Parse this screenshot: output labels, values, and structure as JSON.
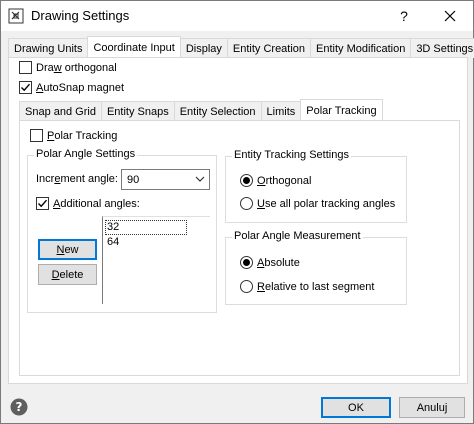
{
  "window": {
    "title": "Drawing Settings",
    "help_glyph": "?",
    "close_glyph": "✕"
  },
  "outer_tabs": [
    {
      "label": "Drawing Units",
      "active": false
    },
    {
      "label": "Coordinate Input",
      "active": true
    },
    {
      "label": "Display",
      "active": false
    },
    {
      "label": "Entity Creation",
      "active": false
    },
    {
      "label": "Entity Modification",
      "active": false
    },
    {
      "label": "3D Settings",
      "active": false
    }
  ],
  "coordinate_input": {
    "draw_orthogonal": {
      "label_pre": "Dra",
      "label_u": "w",
      "label_post": " orthogonal",
      "checked": false
    },
    "autosnap_magnet": {
      "label_pre": "",
      "label_u": "A",
      "label_post": "utoSnap magnet",
      "checked": true
    }
  },
  "inner_tabs": [
    {
      "label": "Snap and Grid",
      "active": false
    },
    {
      "label": "Entity Snaps",
      "active": false
    },
    {
      "label": "Entity Selection",
      "active": false
    },
    {
      "label": "Limits",
      "active": false
    },
    {
      "label": "Polar Tracking",
      "active": true
    }
  ],
  "polar_tracking": {
    "enable": {
      "label_pre": "",
      "label_u": "P",
      "label_post": "olar Tracking",
      "checked": false
    },
    "angle_settings": {
      "legend": "Polar Angle Settings",
      "increment_label_pre": "Incr",
      "increment_label_u": "e",
      "increment_label_post": "ment angle:",
      "increment_value": "90",
      "additional_label_pre": "",
      "additional_label_u": "A",
      "additional_label_post": "dditional angles:",
      "additional_checked": true,
      "additional_angles": [
        "32",
        "64"
      ],
      "new_label_pre": "",
      "new_label_u": "N",
      "new_label_post": "ew",
      "delete_label_pre": "",
      "delete_label_u": "D",
      "delete_label_post": "elete"
    },
    "tracking_settings": {
      "legend": "Entity Tracking Settings",
      "options": [
        {
          "label_pre": "",
          "label_u": "O",
          "label_post": "rthogonal",
          "selected": true
        },
        {
          "label_pre": "",
          "label_u": "U",
          "label_post": "se all polar tracking angles",
          "selected": false
        }
      ]
    },
    "angle_measurement": {
      "legend": "Polar Angle Measurement",
      "options": [
        {
          "label_pre": "",
          "label_u": "A",
          "label_post": "bsolute",
          "selected": true
        },
        {
          "label_pre": "",
          "label_u": "R",
          "label_post": "elative to last segment",
          "selected": false
        }
      ]
    }
  },
  "footer": {
    "help_glyph": "?",
    "ok_label": "OK",
    "cancel_label": "Anuluj"
  },
  "colors": {
    "accent": "#0078d7",
    "help_icon_bg": "#5f5f5f"
  }
}
